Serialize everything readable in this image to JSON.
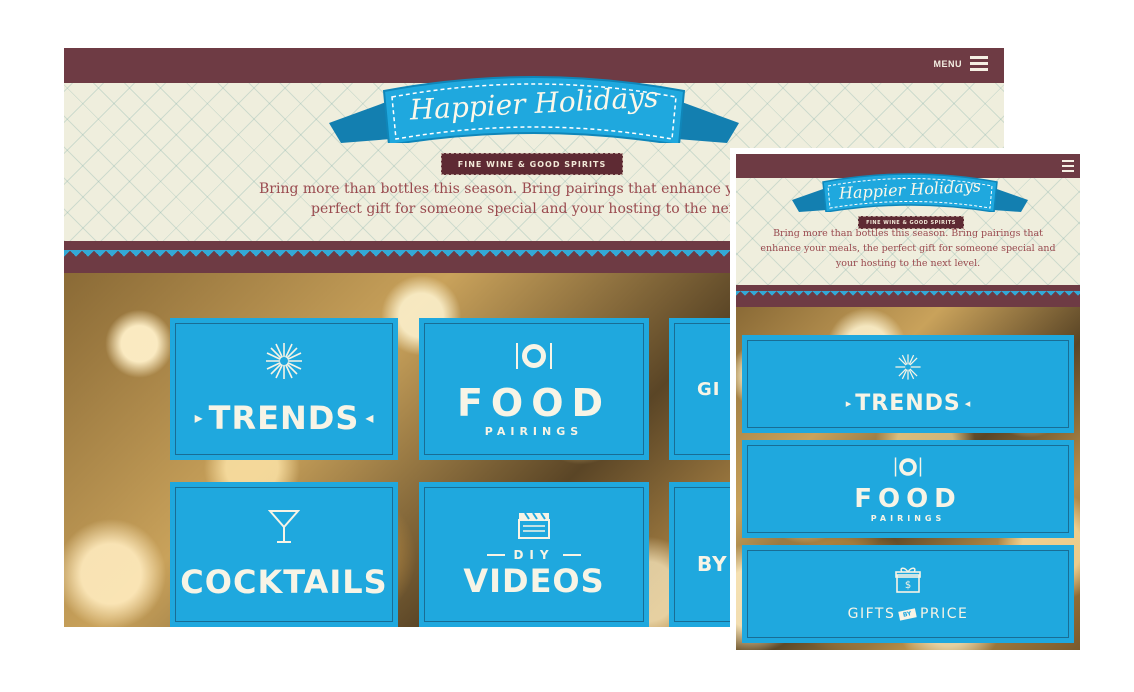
{
  "desktop": {
    "menu_label": "MENU",
    "logo": {
      "title": "Happier Holidays",
      "tagline": "FINE WINE & GOOD SPIRITS"
    },
    "intro_line1": "Bring more than bottles this season. Bring pairings that enhance your",
    "intro_line2": "perfect gift for someone special and your hosting to the next l",
    "tiles": [
      {
        "title": "TRENDS",
        "icon": "starburst-icon"
      },
      {
        "title": "FOOD",
        "subtitle": "PAIRINGS",
        "icon": "plate-icon"
      },
      {
        "title": "GI",
        "icon": "gift-icon"
      },
      {
        "title": "COCKTAILS",
        "icon": "martini-icon"
      },
      {
        "title": "VIDEOS",
        "pretitle": "DIY",
        "icon": "clapperboard-icon"
      },
      {
        "title": "BY",
        "icon": "none"
      }
    ]
  },
  "mobile": {
    "logo": {
      "title": "Happier Holidays",
      "tagline": "FINE WINE & GOOD SPIRITS"
    },
    "intro": "Bring more than bottles this season. Bring pairings that enhance your meals, the perfect gift for someone special and your hosting to the next level.",
    "tiles": [
      {
        "title": "TRENDS",
        "icon": "starburst-icon"
      },
      {
        "title": "FOOD",
        "subtitle": "PAIRINGS",
        "icon": "plate-icon"
      },
      {
        "title_left": "GIFTS",
        "badge": "BY",
        "title_right": "PRICE",
        "icon": "gift-icon"
      }
    ]
  },
  "colors": {
    "maroon": "#6e3b44",
    "tile_blue": "#1fa8de",
    "ribbon_blue": "#2bb3e6",
    "cream": "#efeedd",
    "text_red": "#9a4a4f"
  }
}
